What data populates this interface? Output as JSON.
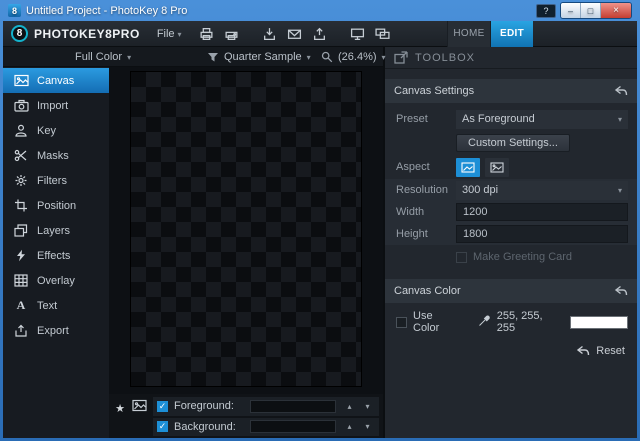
{
  "window": {
    "title": "Untitled Project - PhotoKey 8 Pro",
    "help_label": "?"
  },
  "topbar": {
    "brand_badge": "8",
    "brand": "PHOTOKEY8PRO",
    "file_menu": "File",
    "icons": [
      "print-icon",
      "print-setup-icon",
      "import-file-icon",
      "email-icon",
      "export-file-icon",
      "monitor-icon",
      "dual-monitor-icon"
    ],
    "tabs": [
      {
        "label": "HOME",
        "active": false
      },
      {
        "label": "EDIT",
        "active": true
      }
    ]
  },
  "viewbar": {
    "color_mode": "Full Color",
    "sample_mode": "Quarter Sample",
    "zoom_level": "(26.4%)",
    "icons": [
      "funnel-icon",
      "magnifier-icon"
    ]
  },
  "sidebar": {
    "items": [
      {
        "label": "Canvas",
        "icon": "canvas-icon",
        "active": true
      },
      {
        "label": "Import",
        "icon": "camera-icon",
        "active": false
      },
      {
        "label": "Key",
        "icon": "key-person-icon",
        "active": false
      },
      {
        "label": "Masks",
        "icon": "scissors-icon",
        "active": false
      },
      {
        "label": "Filters",
        "icon": "filters-icon",
        "active": false
      },
      {
        "label": "Position",
        "icon": "position-crop-icon",
        "active": false
      },
      {
        "label": "Layers",
        "icon": "layers-icon",
        "active": false
      },
      {
        "label": "Effects",
        "icon": "effects-icon",
        "active": false
      },
      {
        "label": "Overlay",
        "icon": "overlay-grid-icon",
        "active": false
      },
      {
        "label": "Text",
        "icon": "text-icon",
        "active": false
      },
      {
        "label": "Export",
        "icon": "export-icon",
        "active": false
      }
    ]
  },
  "canvas": {
    "pattern": "transparency-checkerboard"
  },
  "layerbar": {
    "icons": [
      "star-icon",
      "picture-icon"
    ],
    "rows": [
      {
        "label": "Foreground:",
        "checked": true
      },
      {
        "label": "Background:",
        "checked": true
      }
    ]
  },
  "toolbox": {
    "title": "TOOLBOX",
    "canvas_settings": {
      "title": "Canvas Settings",
      "preset": {
        "label": "Preset",
        "value": "As Foreground"
      },
      "custom_button": "Custom Settings...",
      "aspect": {
        "label": "Aspect",
        "options": [
          {
            "icon": "aspect-portrait-icon",
            "active": true
          },
          {
            "icon": "aspect-landscape-icon",
            "active": false
          }
        ]
      },
      "resolution": {
        "label": "Resolution",
        "value": "300 dpi"
      },
      "width": {
        "label": "Width",
        "value": "1200"
      },
      "height": {
        "label": "Height",
        "value": "1800"
      },
      "greeting_card": {
        "label": "Make Greeting Card",
        "checked": false,
        "enabled": false
      }
    },
    "canvas_color": {
      "title": "Canvas Color",
      "use_color": {
        "label": "Use Color",
        "checked": false
      },
      "value": "255, 255, 255",
      "swatch": "#ffffff"
    },
    "reset": "Reset"
  },
  "colors": {
    "accent_blue": "#1d8fd6",
    "titlebar_blue": "#2f7ecb",
    "close_red": "#c43e31",
    "swatch_white": "#ffffff"
  }
}
